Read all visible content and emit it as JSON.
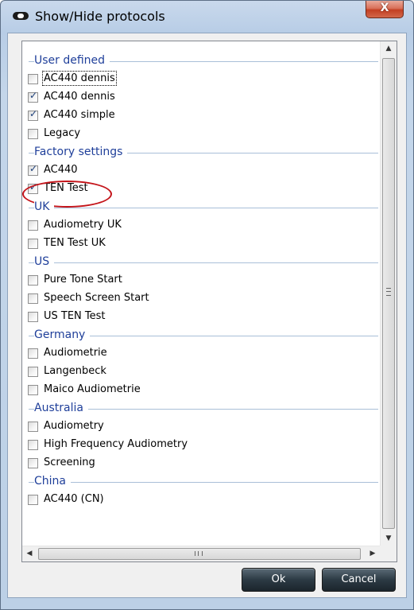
{
  "window": {
    "title": "Show/Hide protocols",
    "close_glyph": "X"
  },
  "groups": [
    {
      "label": "User defined",
      "items": [
        {
          "label": "AC440  dennis",
          "checked": false,
          "focused": true
        },
        {
          "label": "AC440 dennis",
          "checked": true
        },
        {
          "label": "AC440 simple",
          "checked": true
        },
        {
          "label": "Legacy",
          "checked": false
        }
      ]
    },
    {
      "label": "Factory settings",
      "items": [
        {
          "label": "AC440",
          "checked": true
        },
        {
          "label": "TEN Test",
          "checked": true
        }
      ]
    },
    {
      "label": "UK",
      "items": [
        {
          "label": "Audiometry UK",
          "checked": false
        },
        {
          "label": "TEN Test UK",
          "checked": false
        }
      ]
    },
    {
      "label": "US",
      "items": [
        {
          "label": "Pure Tone Start",
          "checked": false
        },
        {
          "label": "Speech Screen Start",
          "checked": false
        },
        {
          "label": "US TEN Test",
          "checked": false
        }
      ]
    },
    {
      "label": "Germany",
      "items": [
        {
          "label": "Audiometrie",
          "checked": false
        },
        {
          "label": "Langenbeck",
          "checked": false
        },
        {
          "label": "Maico Audiometrie",
          "checked": false
        }
      ]
    },
    {
      "label": "Australia",
      "items": [
        {
          "label": "Audiometry",
          "checked": false
        },
        {
          "label": "High Frequency Audiometry",
          "checked": false
        },
        {
          "label": "Screening",
          "checked": false
        }
      ]
    },
    {
      "label": "China",
      "items": [
        {
          "label": "AC440 (CN)",
          "checked": false
        }
      ]
    }
  ],
  "scrollbars": {
    "up_glyph": "▲",
    "down_glyph": "▼",
    "left_glyph": "◀",
    "right_glyph": "▶"
  },
  "buttons": {
    "ok": "Ok",
    "cancel": "Cancel"
  },
  "colors": {
    "group_header": "#1f3f9a",
    "annotation": "#c4141a",
    "button_bg": "#2c3a44"
  }
}
